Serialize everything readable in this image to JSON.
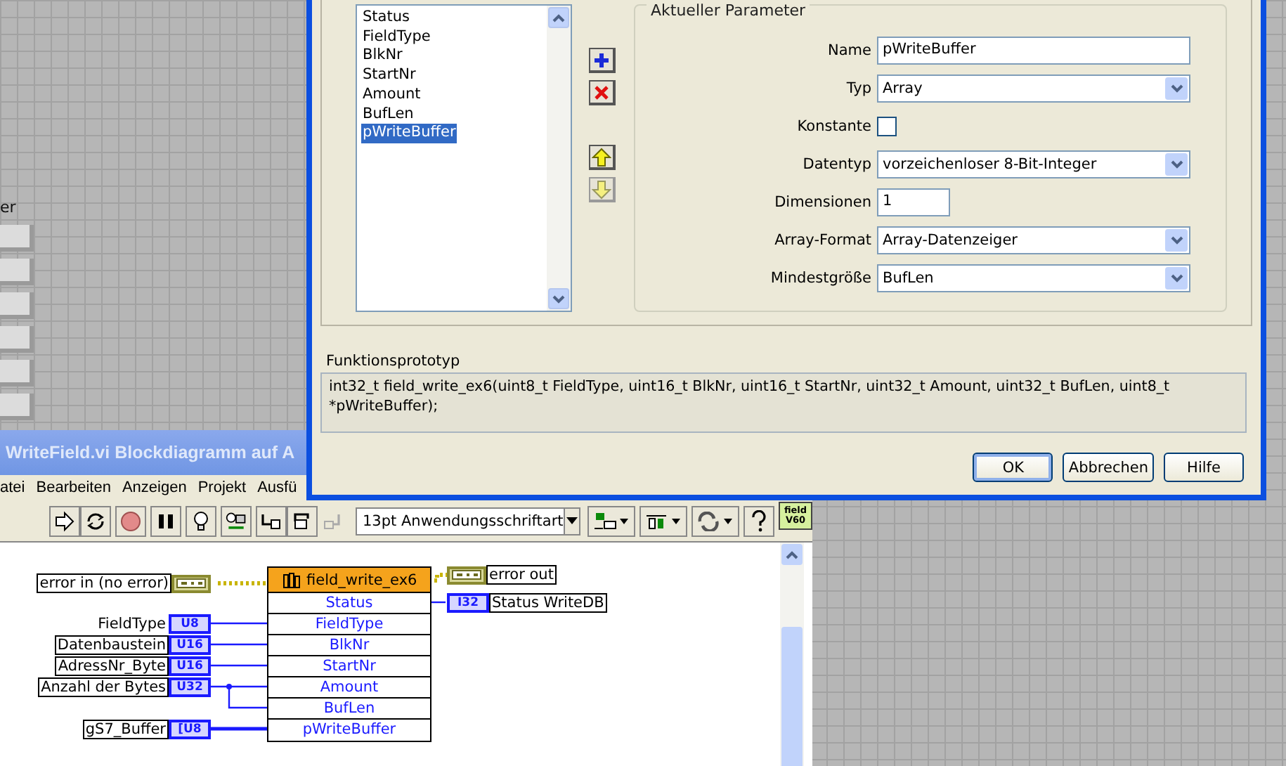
{
  "front_panel": {
    "label": "er"
  },
  "dialog": {
    "parameters": [
      {
        "name": "Status",
        "selected": false
      },
      {
        "name": "FieldType",
        "selected": false
      },
      {
        "name": "BlkNr",
        "selected": false
      },
      {
        "name": "StartNr",
        "selected": false
      },
      {
        "name": "Amount",
        "selected": false
      },
      {
        "name": "BufLen",
        "selected": false
      },
      {
        "name": "pWriteBuffer",
        "selected": true
      }
    ],
    "group_title": "Aktueller Parameter",
    "fields": [
      {
        "kind": "text",
        "label": "Name",
        "value": "pWriteBuffer"
      },
      {
        "kind": "select",
        "label": "Typ",
        "value": "Array"
      },
      {
        "kind": "checkbox",
        "label": "Konstante",
        "checked": false
      },
      {
        "kind": "select",
        "label": "Datentyp",
        "value": "vorzeichenloser 8-Bit-Integer"
      },
      {
        "kind": "short",
        "label": "Dimensionen",
        "value": "1"
      },
      {
        "kind": "select",
        "label": "Array-Format",
        "value": "Array-Datenzeiger"
      },
      {
        "kind": "select",
        "label": "Mindestgröße",
        "value": "BufLen"
      }
    ],
    "prototype_label": "Funktionsprototyp",
    "prototype": "int32_t field_write_ex6(uint8_t FieldType, uint16_t BlkNr, uint16_t StartNr, uint32_t Amount, uint32_t BufLen, uint8_t *pWriteBuffer);",
    "buttons": [
      {
        "label": "OK",
        "default": true
      },
      {
        "label": "Abbrechen",
        "default": false
      },
      {
        "label": "Hilfe",
        "default": false
      }
    ]
  },
  "block_diagram": {
    "title": "WriteField.vi Blockdiagramm auf A",
    "menu": [
      "atei",
      "Bearbeiten",
      "Anzeigen",
      "Projekt",
      "Ausfü"
    ],
    "font_select": "13pt Anwendungsschriftart",
    "vi_icon": [
      "field",
      "V60"
    ],
    "node": {
      "title": "field_write_ex6",
      "terminals": [
        "Status",
        "FieldType",
        "BlkNr",
        "StartNr",
        "Amount",
        "BufLen",
        "pWriteBuffer"
      ]
    },
    "inputs": [
      {
        "kind": "cluster",
        "label": "error in (no error)"
      },
      {
        "kind": "numeric",
        "label": "FieldType",
        "type": "U8"
      },
      {
        "kind": "numeric",
        "label": "Datenbaustein",
        "type": "U16"
      },
      {
        "kind": "numeric",
        "label": "AdressNr_Byte",
        "type": "U16"
      },
      {
        "kind": "numeric",
        "label": "Anzahl der Bytes",
        "type": "U32"
      },
      {
        "kind": "array",
        "label": "gS7_Buffer",
        "type": "[U8"
      }
    ],
    "outputs": [
      {
        "kind": "cluster",
        "label": "error out"
      },
      {
        "kind": "numeric",
        "label": "Status WriteDB",
        "type": "I32"
      }
    ]
  }
}
